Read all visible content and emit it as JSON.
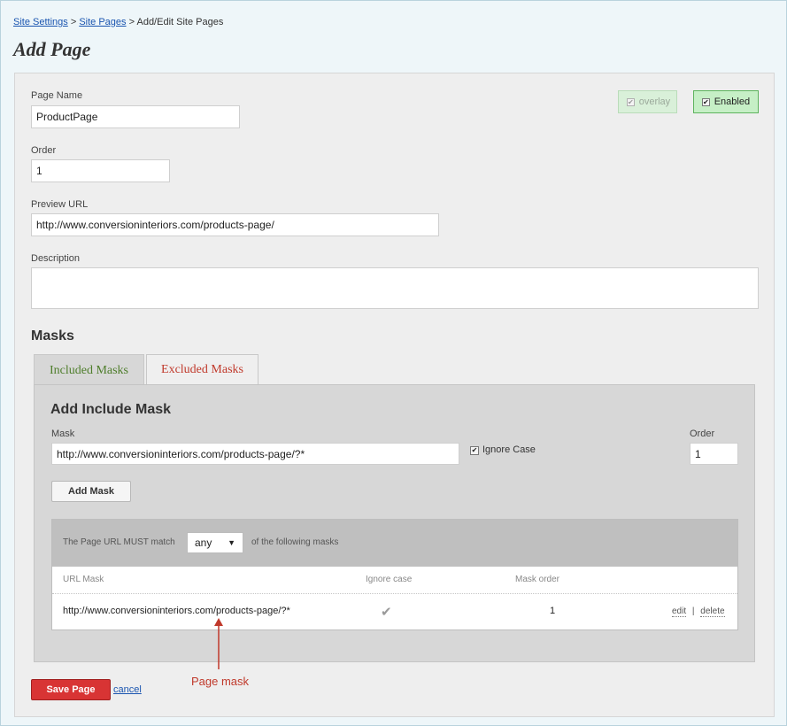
{
  "breadcrumb": {
    "site_settings": "Site Settings",
    "sep1": ">",
    "site_pages": "Site Pages",
    "sep2": ">",
    "current": "Add/Edit Site Pages"
  },
  "page_title": "Add Page",
  "toggles": {
    "overlay_label": "overlay",
    "overlay_checked": true,
    "enabled_label": "Enabled",
    "enabled_checked": true
  },
  "form": {
    "page_name_label": "Page Name",
    "page_name_value": "ProductPage",
    "order_label": "Order",
    "order_value": "1",
    "preview_url_label": "Preview URL",
    "preview_url_value": "http://www.conversioninteriors.com/products-page/",
    "description_label": "Description",
    "description_value": ""
  },
  "masks": {
    "heading": "Masks",
    "tabs": [
      {
        "label": "Included Masks",
        "active": true
      },
      {
        "label": "Excluded Masks",
        "active": false
      }
    ],
    "add_include_title": "Add Include Mask",
    "mask_label": "Mask",
    "mask_value": "http://www.conversioninteriors.com/products-page/?*",
    "ignore_case_label": "Ignore Case",
    "ignore_case_checked": true,
    "order_label": "Order",
    "order_value": "1",
    "add_button": "Add Mask",
    "match_prefix": "The Page URL MUST match",
    "match_selected": "any",
    "match_suffix": "of the following masks",
    "columns": [
      "URL Mask",
      "Ignore case",
      "Mask order"
    ],
    "rows": [
      {
        "url_mask": "http://www.conversioninteriors.com/products-page/?*",
        "ignore_case": true,
        "mask_order": "1",
        "edit": "edit",
        "sep": "|",
        "delete": "delete"
      }
    ]
  },
  "footer": {
    "save_button": "Save Page",
    "cancel_link": "cancel"
  },
  "annotation": {
    "label": "Page mask",
    "color": "#c0392b"
  },
  "colors": {
    "save_red": "#d83434",
    "link_blue": "#1a55b0",
    "included_tab_green": "#4e7d2b",
    "excluded_tab_red": "#c0392b",
    "enabled_green": "#c6efc6"
  }
}
